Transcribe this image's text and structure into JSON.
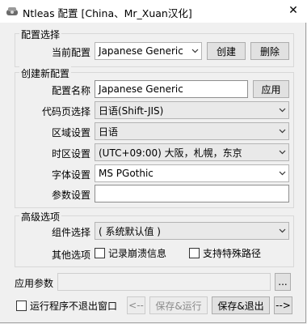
{
  "window": {
    "title": "Ntleas 配置 [China、Mr_Xuan汉化]",
    "close_symbol": "✕"
  },
  "config_select": {
    "group_title": "配置选择",
    "current_label": "当前配置",
    "current_value": "Japanese Generic",
    "create_label": "创建",
    "delete_label": "删除"
  },
  "create_config": {
    "group_title": "创建新配置",
    "name_label": "配置名称",
    "name_value": "Japanese Generic",
    "apply_label": "应用",
    "codepage_label": "代码页选择",
    "codepage_value": "日语(Shift-JIS)",
    "region_label": "区域设置",
    "region_value": "日语",
    "timezone_label": "时区设置",
    "timezone_value": "(UTC+09:00) 大阪，札幌，东京",
    "font_label": "字体设置",
    "font_value": "MS PGothic",
    "params_label": "参数设置",
    "params_value": ""
  },
  "advanced": {
    "group_title": "高级选项",
    "component_label": "组件选择",
    "component_value": "( 系统默认值 )",
    "other_label": "其他选项",
    "crash_log_label": "记录崩溃信息",
    "crash_log_checked": false,
    "special_path_label": "支持特殊路径",
    "special_path_checked": false
  },
  "bottom": {
    "app_params_label": "应用参数",
    "app_params_value": "",
    "browse_label": "...",
    "keep_open_label": "运行程序不退出窗口",
    "keep_open_checked": false,
    "back_label": "<--",
    "save_run_label": "保存&运行",
    "save_exit_label": "保存&退出",
    "next_label": "-->"
  },
  "icons": {
    "app": "ntleas-app-icon",
    "close": "close-icon",
    "dropdown": "chevron-down-icon",
    "checkbox": "checkbox-icon"
  }
}
